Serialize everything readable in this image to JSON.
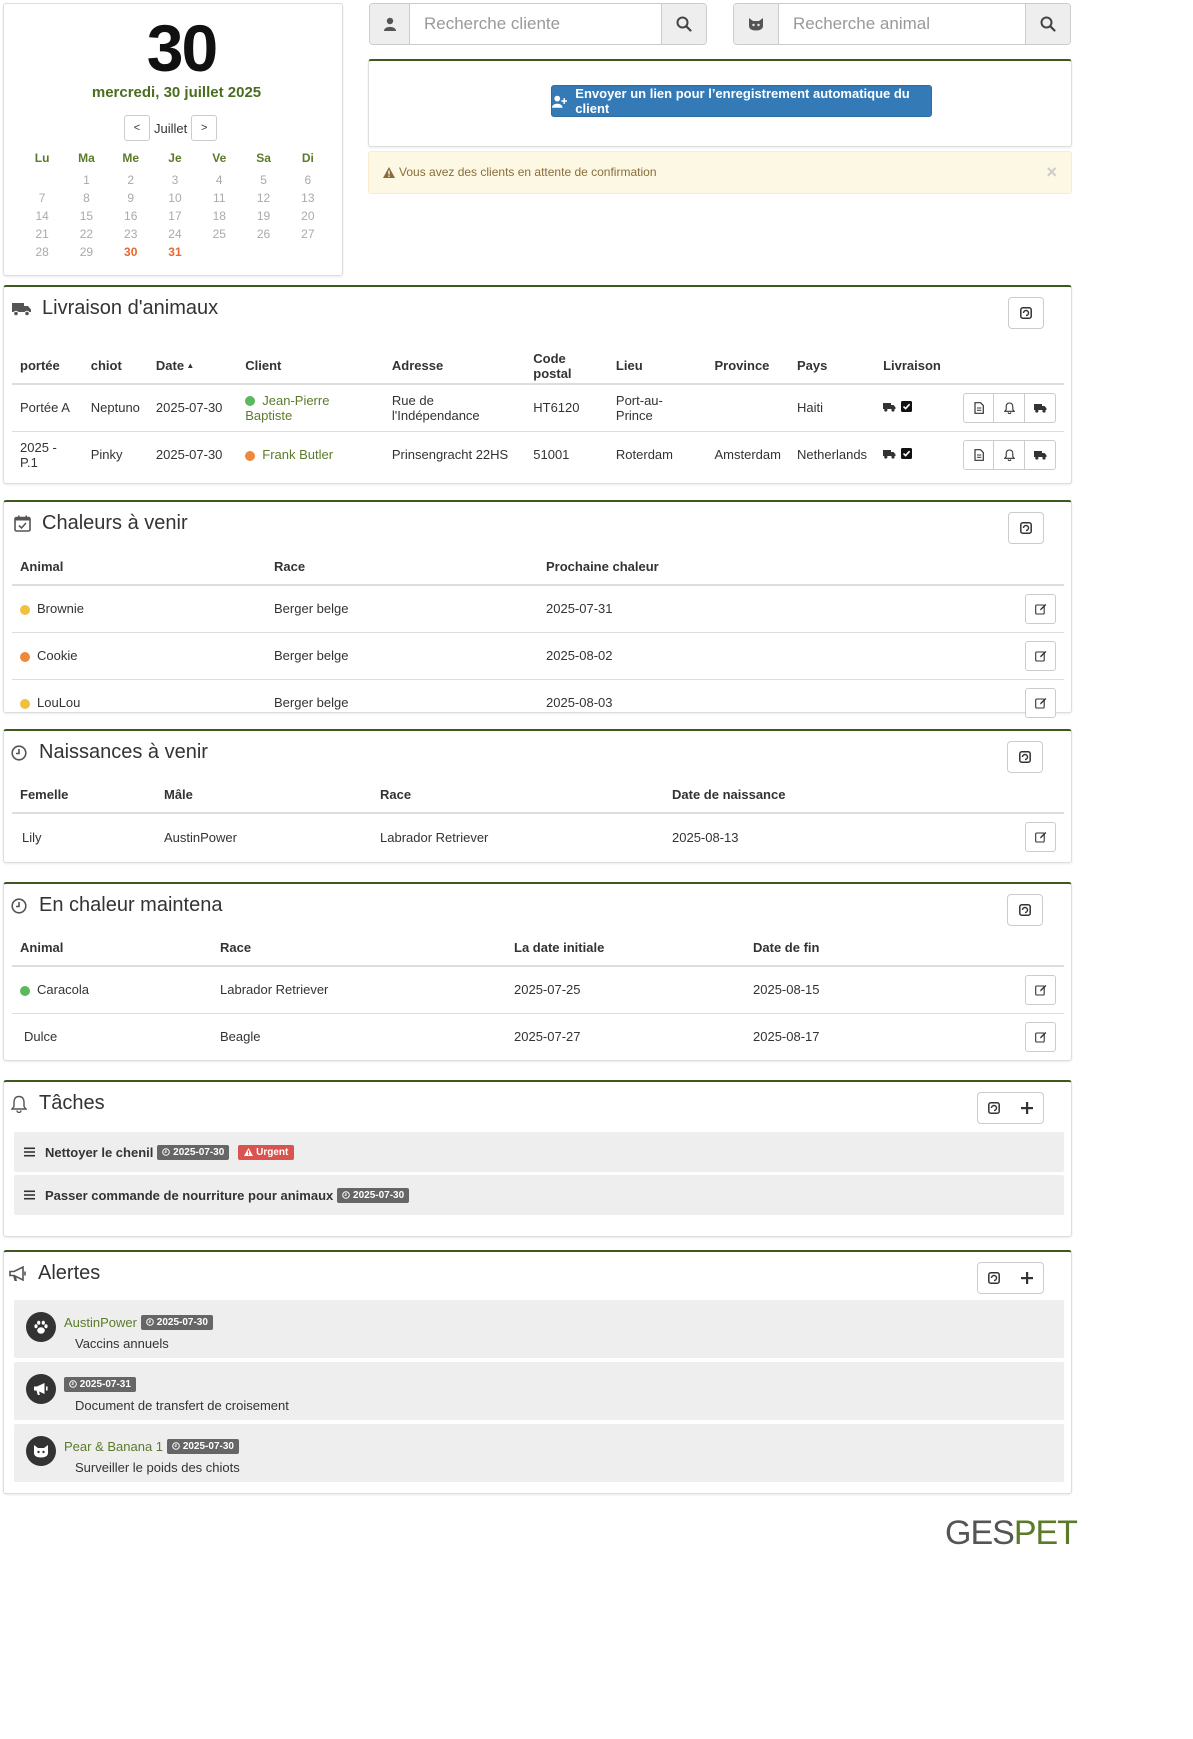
{
  "calendar": {
    "day_number": "30",
    "date_long": "mercredi, 30 juillet 2025",
    "prev_label": "<",
    "month_label": "Juillet",
    "next_label": ">",
    "weekdays": [
      "Lu",
      "Ma",
      "Me",
      "Je",
      "Ve",
      "Sa",
      "Di"
    ],
    "weeks": [
      [
        "",
        "1",
        "2",
        "3",
        "4",
        "5",
        "6"
      ],
      [
        "7",
        "8",
        "9",
        "10",
        "11",
        "12",
        "13"
      ],
      [
        "14",
        "15",
        "16",
        "17",
        "18",
        "19",
        "20"
      ],
      [
        "21",
        "22",
        "23",
        "24",
        "25",
        "26",
        "27"
      ],
      [
        "28",
        "29",
        "30",
        "31",
        "",
        "",
        ""
      ]
    ],
    "highlighted_days": [
      "30",
      "31"
    ]
  },
  "search": {
    "client_placeholder": "Recherche cliente",
    "animal_placeholder": "Recherche animal"
  },
  "registration": {
    "button_label": "Envoyer un lien pour l’enregistrement  automatique du client"
  },
  "notice": {
    "text": "Vous avez des clients en attente de confirmation",
    "close": "×"
  },
  "deliveries": {
    "title": "Livraison d'animaux",
    "headers": [
      "portée",
      "chiot",
      "Date",
      "Client",
      "Adresse",
      "Code postal",
      "Lieu",
      "Province",
      "Pays",
      "Livraison"
    ],
    "rows": [
      {
        "litter": "Portée A",
        "puppy": "Neptuno",
        "date": "2025-07-30",
        "client": "Jean-Pierre Baptiste",
        "client_color": "#5cb85c",
        "address": "Rue de l'Indépendance",
        "postal": "HT6120",
        "place": "Port-au-Prince",
        "province": "",
        "country": "Haiti"
      },
      {
        "litter": "2025 - P.1",
        "puppy": "Pinky",
        "date": "2025-07-30",
        "client": "Frank Butler",
        "client_color": "#f0883a",
        "address": "Prinsengracht 22HS",
        "postal": "51001",
        "place": "Roterdam",
        "province": "Amsterdam",
        "country": "Netherlands"
      }
    ]
  },
  "heats": {
    "title": "Chaleurs à venir",
    "headers": [
      "Animal",
      "Race",
      "Prochaine chaleur"
    ],
    "rows": [
      {
        "animal": "Brownie",
        "color": "#f0c040",
        "race": "Berger belge",
        "next": "2025-07-31"
      },
      {
        "animal": "Cookie",
        "color": "#f0883a",
        "race": "Berger belge",
        "next": "2025-08-02"
      },
      {
        "animal": "LouLou",
        "color": "#f0c040",
        "race": "Berger belge",
        "next": "2025-08-03"
      }
    ]
  },
  "births": {
    "title": "Naissances à venir",
    "headers": [
      "Femelle",
      "Mâle",
      "Race",
      "Date de naissance"
    ],
    "rows": [
      {
        "female": "Lily",
        "male": "AustinPower",
        "race": "Labrador Retriever",
        "date": "2025-08-13"
      }
    ]
  },
  "in_heat": {
    "title": "En chaleur maintena",
    "headers": [
      "Animal",
      "Race",
      "La date initiale",
      "Date de fin"
    ],
    "rows": [
      {
        "animal": "Caracola",
        "color": "#5cb85c",
        "race": "Labrador Retriever",
        "start": "2025-07-25",
        "end": "2025-08-15"
      },
      {
        "animal": "Dulce",
        "color": "",
        "race": "Beagle",
        "start": "2025-07-27",
        "end": "2025-08-17"
      }
    ]
  },
  "tasks": {
    "title": "Tâches",
    "items": [
      {
        "label": "Nettoyer le chenil",
        "date": "2025-07-30",
        "urgent": "Urgent"
      },
      {
        "label": "Passer commande de nourriture pour animaux",
        "date": "2025-07-30",
        "urgent": ""
      }
    ]
  },
  "alerts": {
    "title": "Alertes",
    "items": [
      {
        "icon": "paw-icon",
        "name": "AustinPower",
        "date": "2025-07-30",
        "text": "Vaccins annuels"
      },
      {
        "icon": "megaphone-icon",
        "name": "",
        "date": "2025-07-31",
        "text": "Document de transfert de croisement"
      },
      {
        "icon": "cat-icon",
        "name": "Pear & Banana 1",
        "date": "2025-07-30",
        "text": "Surveiller le poids des chiots"
      }
    ]
  },
  "footer": {
    "logo_ges": "GES",
    "logo_pet": "PET"
  },
  "colors": {
    "brand_green": "#3c5a1e",
    "link_green": "#5b7b2a",
    "primary_blue": "#337ab7",
    "today_orange": "#e8672f",
    "urgent_red": "#d9534f"
  }
}
